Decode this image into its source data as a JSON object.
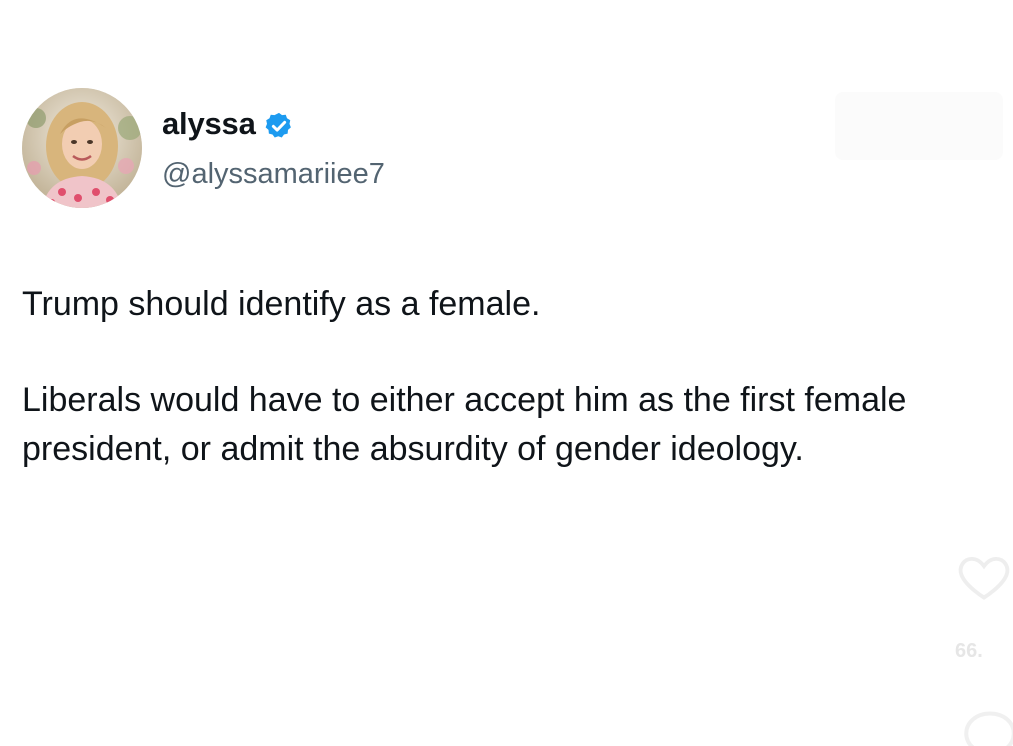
{
  "author": {
    "display_name": "alyssa",
    "handle": "@alyssamariiee7",
    "verified": true,
    "verified_color": "#1d9bf0"
  },
  "tweet": {
    "paragraphs": [
      "Trump should identify as a female.",
      "Liberals would have to either accept him as the first female president, or admit the absurdity of gender ideology."
    ]
  },
  "overlay": {
    "like_count": "66.",
    "icons": [
      "heart-icon",
      "comment-icon"
    ]
  }
}
